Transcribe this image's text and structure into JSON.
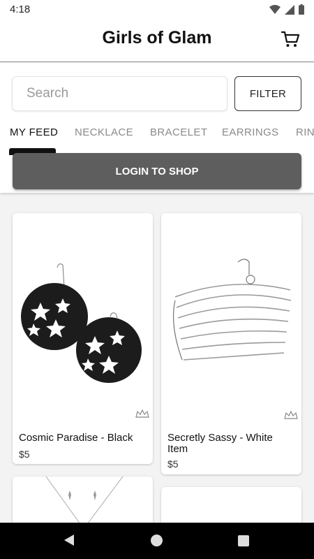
{
  "status_bar": {
    "time": "4:18"
  },
  "header": {
    "title": "Girls of Glam"
  },
  "search": {
    "placeholder": "Search",
    "value": ""
  },
  "filter": {
    "label": "FILTER"
  },
  "tabs": [
    {
      "label": "MY FEED",
      "active": true
    },
    {
      "label": "NECKLACE"
    },
    {
      "label": "BRACELET"
    },
    {
      "label": "EARRINGS"
    },
    {
      "label": "RIN"
    }
  ],
  "login": {
    "label": "LOGIN TO SHOP"
  },
  "products": [
    {
      "name": "Cosmic Paradise - Black",
      "price": "$5"
    },
    {
      "name": "Secretly Sassy - White Item",
      "price": "$5"
    }
  ],
  "icons": {
    "cart": "cart-icon",
    "crown": "crown-icon",
    "wifi": "wifi-icon",
    "signal": "signal-icon",
    "battery": "battery-icon"
  }
}
